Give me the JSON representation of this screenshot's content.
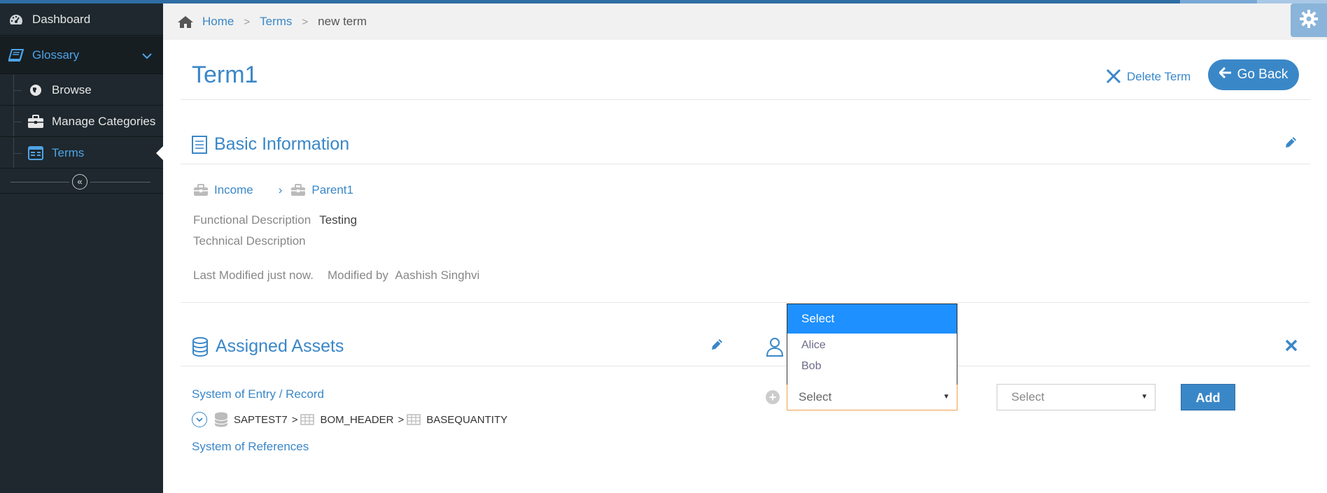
{
  "sidebar": {
    "dashboard": "Dashboard",
    "glossary": "Glossary",
    "browse": "Browse",
    "manage_categories": "Manage Categories",
    "terms": "Terms"
  },
  "breadcrumb": [
    "Home",
    "Terms",
    "new term"
  ],
  "page": {
    "title": "Term1",
    "delete_label": "Delete Term",
    "goback_label": "Go Back"
  },
  "basic_info": {
    "heading": "Basic Information",
    "category_path": [
      "Income",
      "Parent1"
    ],
    "functional_description_label": "Functional Description",
    "functional_description_value": "Testing",
    "technical_description_label": "Technical Description",
    "last_modified": "Last Modified just now.",
    "modified_by_label": "Modified by",
    "modified_by_value": "Aashish Singhvi"
  },
  "assigned_assets": {
    "heading": "Assigned Assets",
    "system_of_entry": "System of Entry / Record",
    "path": [
      "SAPTEST7",
      "BOM_HEADER",
      "BASEQUANTITY"
    ],
    "system_of_references": "System of References"
  },
  "assign": {
    "select1_value": "Select",
    "select2_value": "Select",
    "add_label": "Add",
    "dropdown_options": [
      "Select",
      "Alice",
      "Bob"
    ]
  },
  "colors": {
    "accent": "#3a87c8",
    "sidebar_bg": "#1e282e",
    "dropdown_selected": "#1e90ff",
    "focus_border": "#f0a04b"
  }
}
